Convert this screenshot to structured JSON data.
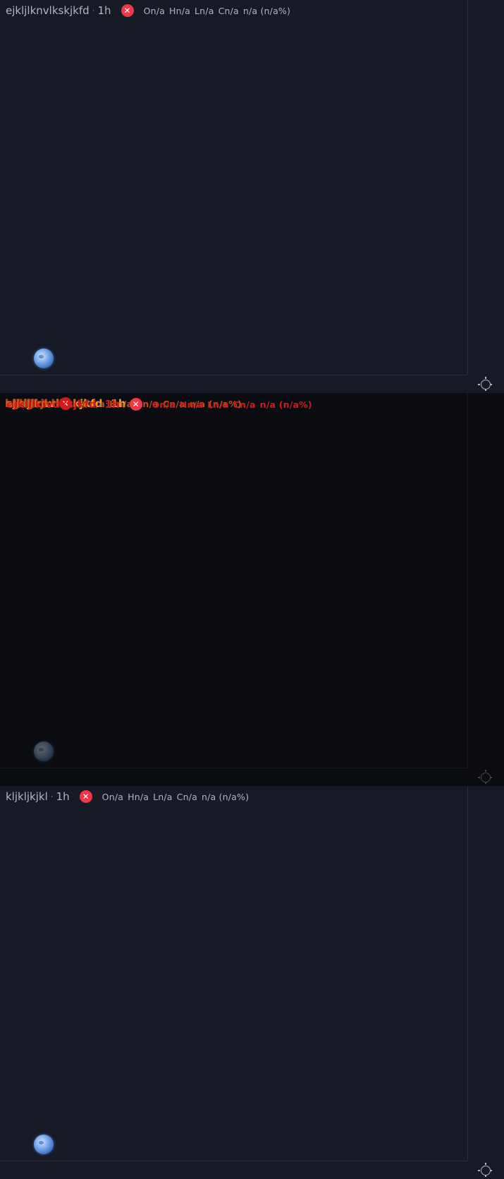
{
  "panes": [
    {
      "symbol": "ejkljlknvlkskjkfd",
      "separator": "·",
      "interval": "1h",
      "error_icon": "close-icon",
      "ohlc": {
        "open": "On/a",
        "high": "Hn/a",
        "low": "Ln/a",
        "close": "Cn/a",
        "change": "n/a (n/a%)"
      }
    },
    {
      "symbol": "ejkljlkivdksjkfd",
      "separator": "·",
      "interval": "1h",
      "error_icon": "close-icon",
      "ohlc": {
        "open": "On/a",
        "high": "Hn/a",
        "low": "Ln/a",
        "close": "Cn/a",
        "change": "n/a (n/a%)"
      },
      "ghost_symbols": [
        "ejkljlknvlkskjkfd",
        "kljkljkjkl"
      ],
      "state": "dimmed"
    },
    {
      "symbol": "kljkljkjkl",
      "separator": "·",
      "interval": "1h",
      "error_icon": "close-icon",
      "ohlc": {
        "open": "On/a",
        "high": "Hn/a",
        "low": "Ln/a",
        "close": "Cn/a",
        "change": "n/a (n/a%)"
      }
    }
  ],
  "icons": {
    "logo": "moon-logo-icon",
    "settings": "gear-icon"
  },
  "colors": {
    "background": "#161a25",
    "dim_background": "#0a0c11",
    "error": "#f23645",
    "text": "#b2b5be",
    "ghost_orange": "#f0a030",
    "ghost_red": "#d11b1b"
  }
}
